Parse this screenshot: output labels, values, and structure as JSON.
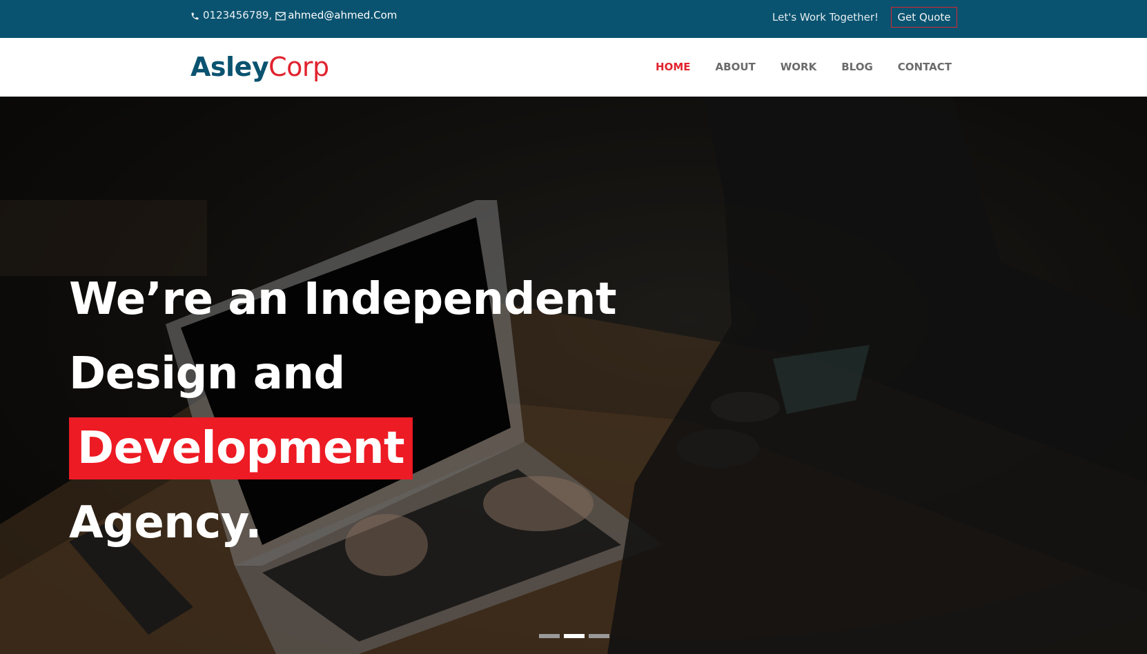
{
  "topbar": {
    "phone": "0123456789,",
    "email": "ahmed@ahmed.Com",
    "tagline": "Let's Work Together!",
    "quote_label": "Get Quote"
  },
  "header": {
    "logo_part1": "Asley",
    "logo_part2": "Corp",
    "nav": [
      "HOME",
      "ABOUT",
      "WORK",
      "BLOG",
      "CONTACT"
    ],
    "active_nav": "HOME"
  },
  "hero": {
    "line1": "We’re an Independent",
    "line2_prefix": "Design and ",
    "line2_highlight": "Development",
    "line3": "Agency.",
    "slides": 3,
    "active_slide": 2
  },
  "colors": {
    "primary": "#0a5370",
    "accent": "#ed1b24"
  }
}
